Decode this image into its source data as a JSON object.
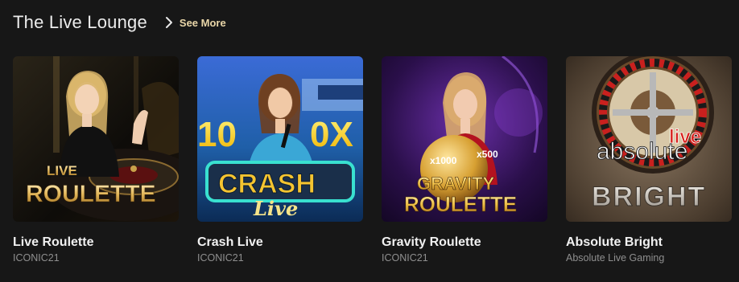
{
  "section": {
    "title": "The Live Lounge",
    "see_more_label": "See More"
  },
  "colors": {
    "background": "#171717",
    "accent": "#e9d6a8",
    "provider_text": "#8f8f8f"
  },
  "games": [
    {
      "title": "Live Roulette",
      "provider": "ICONIC21",
      "art": {
        "line1": "LIVE",
        "line2": "ROULETTE"
      }
    },
    {
      "title": "Crash Live",
      "provider": "ICONIC21",
      "art": {
        "multiplier_left": "10",
        "multiplier_right": "0X",
        "logo": "CRASH",
        "logo_sub": "Live"
      }
    },
    {
      "title": "Gravity Roulette",
      "provider": "ICONIC21",
      "art": {
        "tag1": "x1000",
        "tag2": "x500",
        "line1": "GRAVITY",
        "line2": "ROULETTE"
      }
    },
    {
      "title": "Absolute Bright",
      "provider": "Absolute Live Gaming",
      "art": {
        "word1": "absolute",
        "word2": "live",
        "word3": "BRIGHT"
      }
    }
  ]
}
